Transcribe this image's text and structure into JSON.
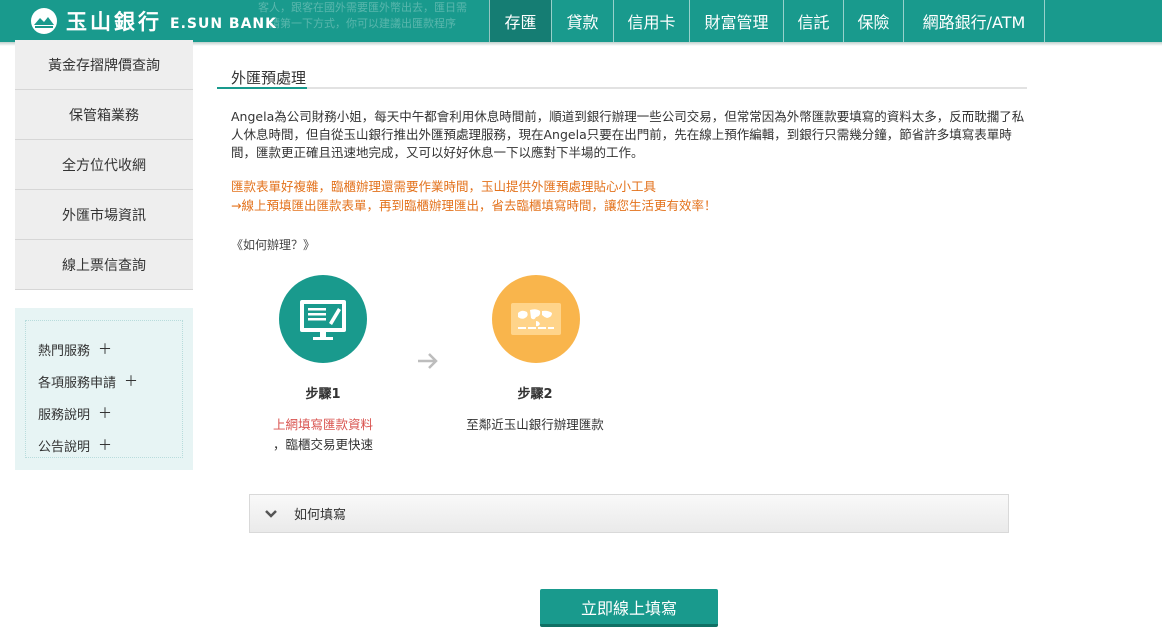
{
  "brand": {
    "name_cn": "玉山銀行",
    "name_en": "E.SUN BANK"
  },
  "header_ghost": [
    "客人，跟客在國外需要匯外幣出去，匯日需",
    "，請第一下方式，你可以建議出匯款程序"
  ],
  "nav": [
    {
      "label": "存匯",
      "active": true
    },
    {
      "label": "貸款",
      "active": false
    },
    {
      "label": "信用卡",
      "active": false
    },
    {
      "label": "財富管理",
      "active": false
    },
    {
      "label": "信託",
      "active": false
    },
    {
      "label": "保險",
      "active": false
    },
    {
      "label": "網路銀行/ATM",
      "active": false
    }
  ],
  "sidebar": {
    "items": [
      "黃金存摺牌價查詢",
      "保管箱業務",
      "全方位代收網",
      "外匯市場資訊",
      "線上票信查詢"
    ],
    "links": [
      "熱門服務",
      "各項服務申請",
      "服務說明",
      "公告說明"
    ],
    "plus": "＋"
  },
  "content": {
    "title": "外匯預處理",
    "paragraph": "Angela為公司財務小姐，每天中午都會利用休息時間前，順道到銀行辦理一些公司交易，但常常因為外幣匯款要填寫的資料太多，反而耽擱了私人休息時間，但自從玉山銀行推出外匯預處理服務，現在Angela只要在出門前，先在線上預作編輯，到銀行只需幾分鐘，節省許多填寫表單時間，匯款更正確且迅速地完成，又可以好好休息一下以應對下半場的工作。",
    "highlight_1": "匯款表單好複雜，臨櫃辦理還需要作業時間，玉山提供外匯預處理貼心小工具",
    "highlight_2": "→線上預填匯出匯款表單，再到臨櫃辦理匯出，省去臨櫃填寫時間，讓您生活更有效率！",
    "howto": "《如何辦理？》",
    "steps": [
      {
        "title": "步驟1",
        "desc_red": "上網填寫匯款資料",
        "desc": "，臨櫃交易更快速"
      },
      {
        "title": "步驟2",
        "desc": "至鄰近玉山銀行辦理匯款"
      }
    ],
    "accordion": "如何填寫",
    "cta": "立即線上填寫"
  },
  "colors": {
    "brand": "#199a8d",
    "orange": "#e3721c",
    "step2": "#f9b54c",
    "red": "#d9534f"
  }
}
